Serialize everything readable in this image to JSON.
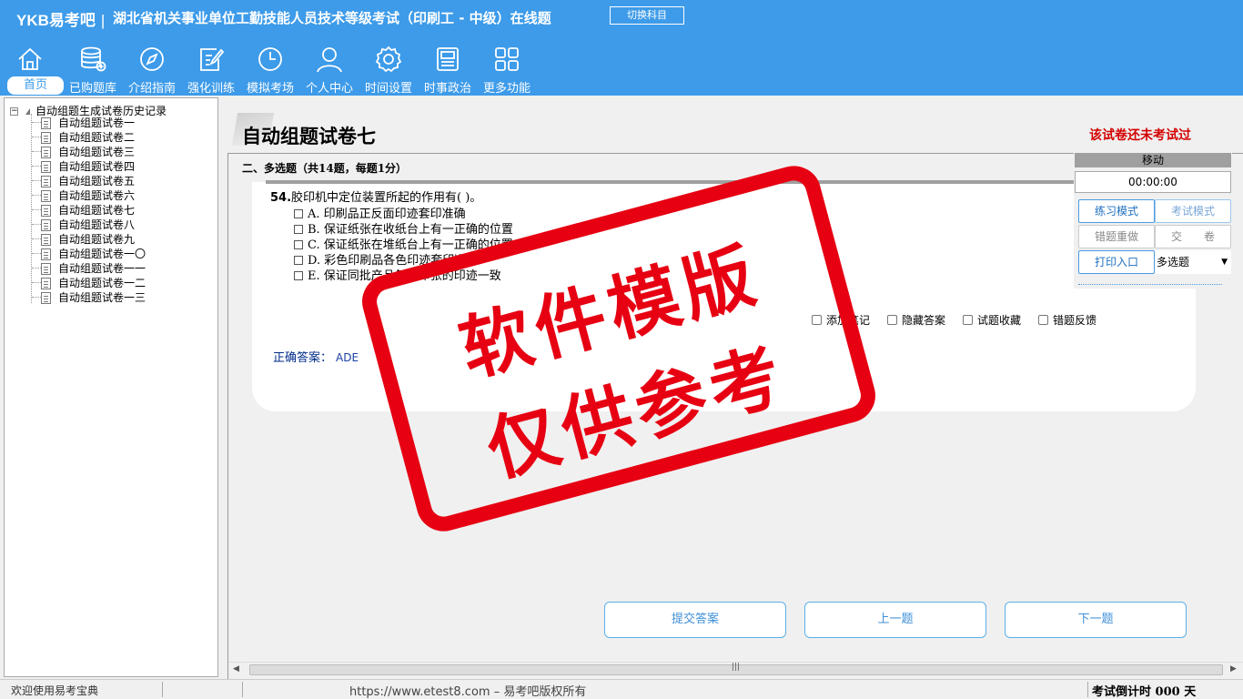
{
  "header": {
    "logo": "YKB易考吧",
    "title": "湖北省机关事业单位工勤技能人员技术等级考试（印刷工 - 中级）在线题",
    "switch_label": "切换科目"
  },
  "nav": [
    {
      "label": "首页",
      "icon": "home-icon"
    },
    {
      "label": "已购题库",
      "icon": "database-icon"
    },
    {
      "label": "介绍指南",
      "icon": "compass-icon"
    },
    {
      "label": "强化训练",
      "icon": "edit-icon"
    },
    {
      "label": "模拟考场",
      "icon": "clock-icon"
    },
    {
      "label": "个人中心",
      "icon": "user-icon"
    },
    {
      "label": "时间设置",
      "icon": "gear-icon"
    },
    {
      "label": "时事政治",
      "icon": "news-icon"
    },
    {
      "label": "更多功能",
      "icon": "grid-icon"
    }
  ],
  "tree": {
    "root": "自动组题生成试卷历史记录",
    "items": [
      "自动组题试卷一",
      "自动组题试卷二",
      "自动组题试卷三",
      "自动组题试卷四",
      "自动组题试卷五",
      "自动组题试卷六",
      "自动组题试卷七",
      "自动组题试卷八",
      "自动组题试卷九",
      "自动组题试卷一〇",
      "自动组题试卷一一",
      "自动组题试卷一二",
      "自动组题试卷一三"
    ]
  },
  "paper": {
    "title": "自动组题试卷七",
    "status": "该试卷还未考试过",
    "section": "二、多选题（共14题，每题1分）"
  },
  "question": {
    "number": "54.",
    "text": "胶印机中定位装置所起的作用有( )。",
    "options": [
      "A. 印刷品正反面印迹套印准确",
      "B. 保证纸张在收纸台上有一正确的位置",
      "C. 保证纸张在堆纸台上有一正确的位置",
      "D. 彩色印刷品各色印迹套印准确",
      "E. 保证同批产品每一印张的印迹一致"
    ],
    "answer_label": "正确答案：",
    "answer_value": "ADE"
  },
  "tools": {
    "add_note": "添加笔记",
    "hide_answer": "隐藏答案",
    "favorite": "试题收藏",
    "feedback": "错题反馈"
  },
  "buttons": {
    "submit": "提交答案",
    "prev": "上一题",
    "next": "下一题"
  },
  "timer": {
    "move": "移动",
    "time": "00:00:00",
    "practice_mode": "练习模式",
    "exam_mode": "考试模式",
    "redo_wrong": "错题重做",
    "hand_in": "交　　卷",
    "print": "打印入口",
    "type_select": "多选题"
  },
  "status_bar": {
    "welcome": "欢迎使用易考宝典",
    "url": "https://www.etest8.com – 易考吧版权所有",
    "countdown": "考试倒计时 000 天"
  },
  "watermark": {
    "line1": "软件模版",
    "line2": "仅供参考"
  },
  "colors": {
    "header_bg": "#3d9be9",
    "status_red": "#d40000",
    "stamp_red": "#e60012"
  }
}
